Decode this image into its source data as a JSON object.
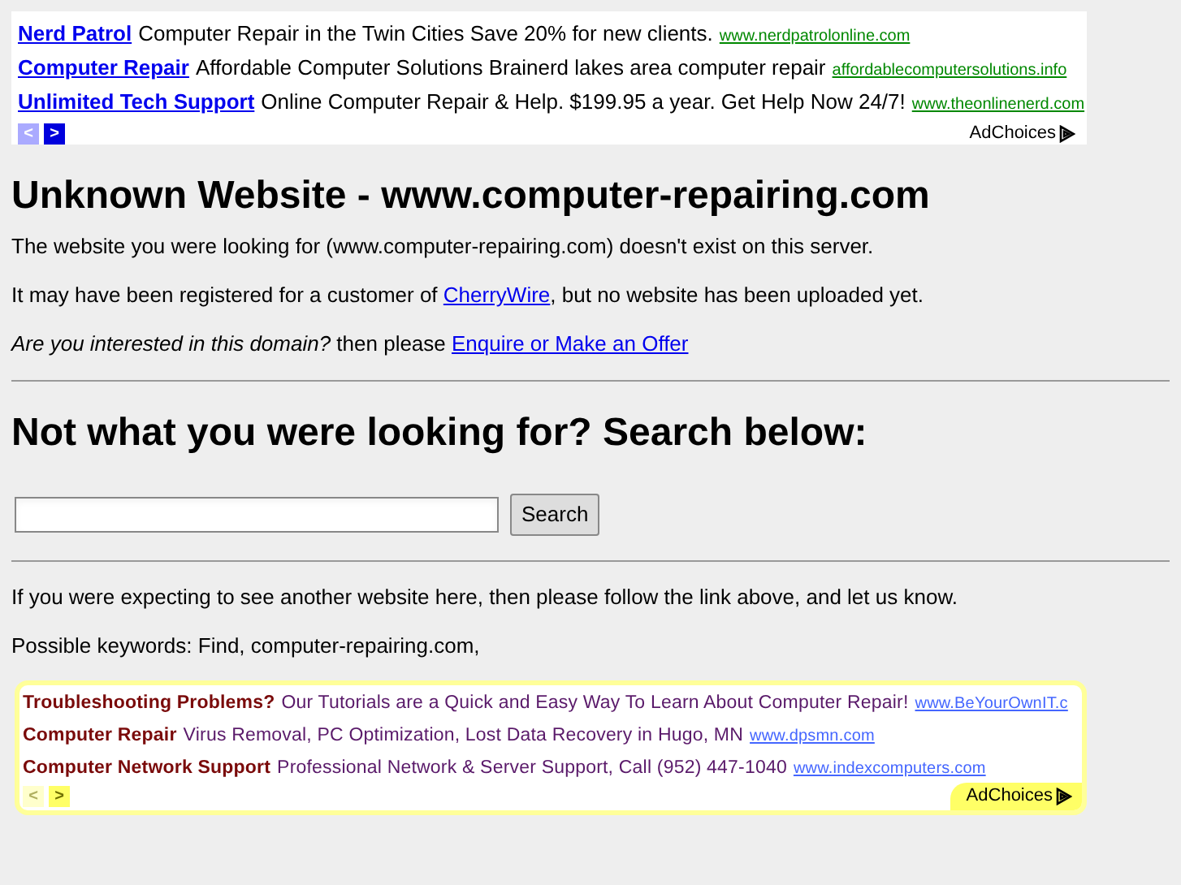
{
  "top_ads": {
    "items": [
      {
        "title": "Nerd Patrol",
        "text": "Computer Repair in the Twin Cities Save 20% for new clients.",
        "url": "www.nerdpatrolonline.com"
      },
      {
        "title": "Computer Repair",
        "text": "Affordable Computer Solutions Brainerd lakes area computer repair",
        "url": "affordablecomputersolutions.info"
      },
      {
        "title": "Unlimited Tech Support",
        "text": "Online Computer Repair & Help. $199.95 a year. Get Help Now 24/7!",
        "url": "www.theonlinenerd.com"
      }
    ],
    "nav": [
      {
        "glyph": "<",
        "disabled": true
      },
      {
        "glyph": ">",
        "disabled": false
      }
    ],
    "adchoices": "AdChoices"
  },
  "heading": "Unknown Website - www.computer-repairing.com",
  "paragraphs": [
    {
      "parts": [
        {
          "text": "The website you were looking for (www.computer-repairing.com) doesn't exist on this server."
        }
      ]
    },
    {
      "parts": [
        {
          "text": "It may have been registered for a customer of "
        },
        {
          "text": "CherryWire",
          "link": true
        },
        {
          "text": ", but no website has been uploaded yet."
        }
      ]
    },
    {
      "parts": [
        {
          "text": "Are you interested in this domain?",
          "italic": true
        },
        {
          "text": " then please "
        },
        {
          "text": "Enquire or Make an Offer",
          "link": true
        }
      ]
    }
  ],
  "search_heading": "Not what you were looking for? Search below:",
  "search_button": "Search",
  "notes": [
    "If you were expecting to see another website here, then please follow the link above, and let us know.",
    "Possible keywords: Find, computer-repairing.com,"
  ],
  "bottom_ads": {
    "items": [
      {
        "title": "Troubleshooting Problems?",
        "text": "Our Tutorials are a Quick and Easy Way To Learn About Computer Repair!",
        "url": "www.BeYourOwnIT.c"
      },
      {
        "title": "Computer Repair",
        "text": "Virus Removal, PC Optimization, Lost Data Recovery in Hugo, MN",
        "url": "www.dpsmn.com"
      },
      {
        "title": "Computer Network Support",
        "text": "Professional Network & Server Support, Call (952) 447-1040",
        "url": "www.indexcomputers.com"
      }
    ],
    "nav": [
      {
        "glyph": "<",
        "disabled": true
      },
      {
        "glyph": ">",
        "disabled": false
      }
    ],
    "adchoices": "AdChoices"
  }
}
